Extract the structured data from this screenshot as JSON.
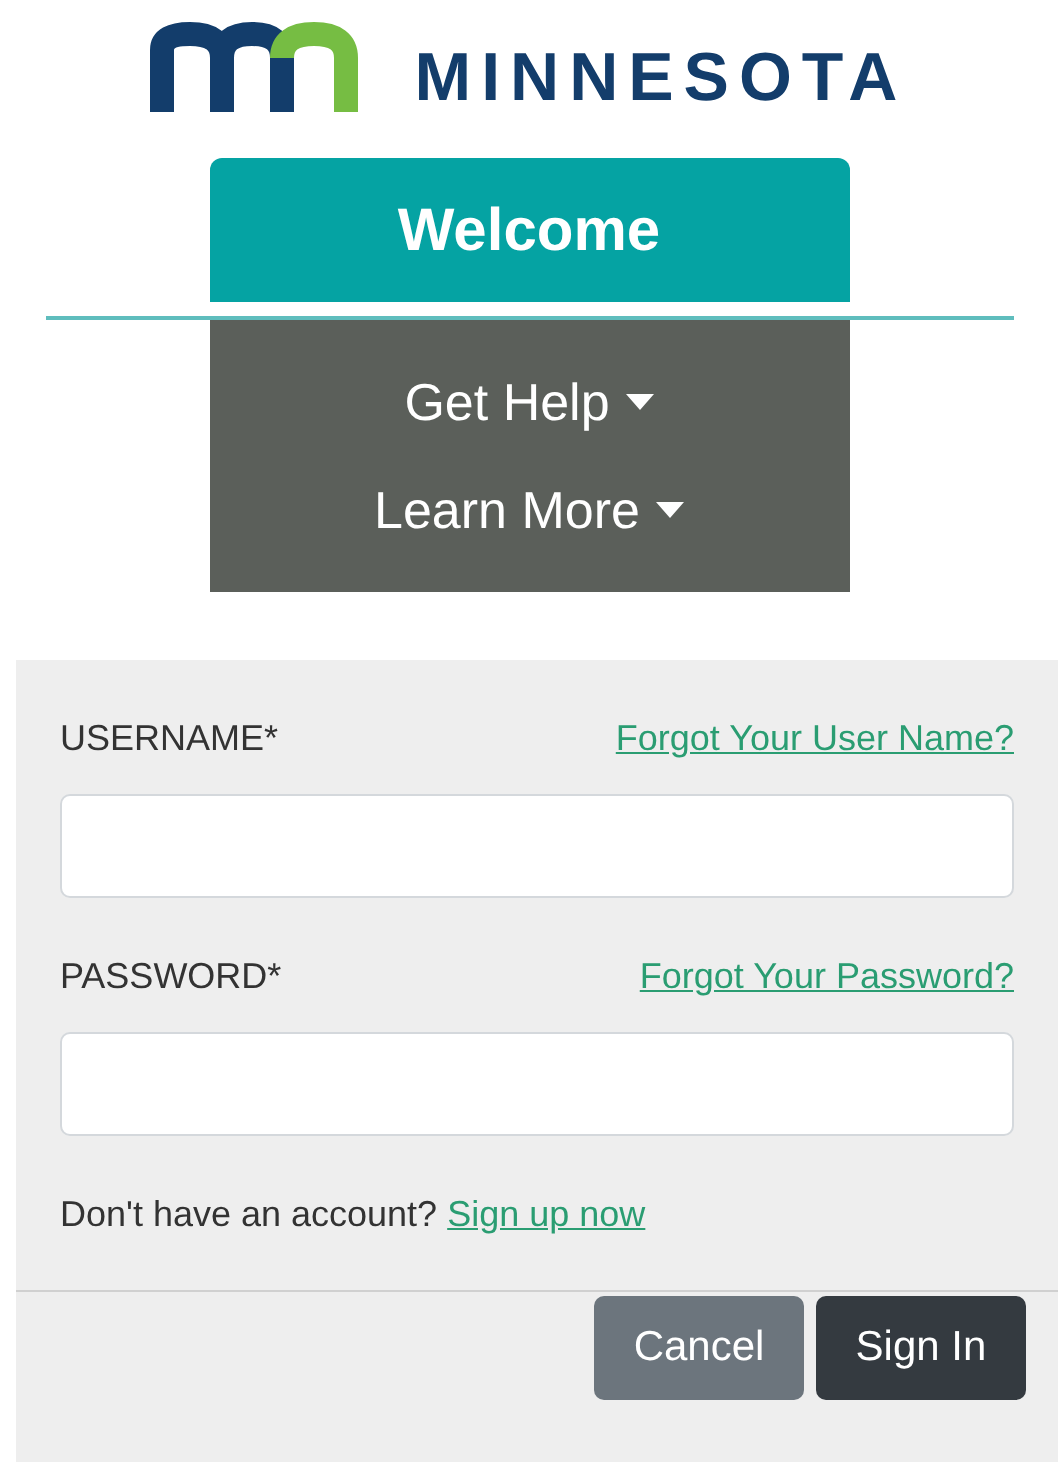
{
  "logo": {
    "wordmark": "MINNESOTA"
  },
  "tabs": [
    {
      "label": "Welcome",
      "selected": true
    }
  ],
  "menus": [
    {
      "label": "Get Help"
    },
    {
      "label": "Learn More"
    }
  ],
  "fields": [
    {
      "label": "USERNAME*",
      "link": "Forgot Your User Name?"
    },
    {
      "label": "PASSWORD*",
      "link": "Forgot Your Password?"
    }
  ],
  "signup": {
    "text": "Don't have an account?",
    "link": "Sign up now"
  },
  "buttons": [
    {
      "label": "Cancel",
      "kind": "secondary"
    },
    {
      "label": "Sign In",
      "kind": "primary"
    }
  ]
}
